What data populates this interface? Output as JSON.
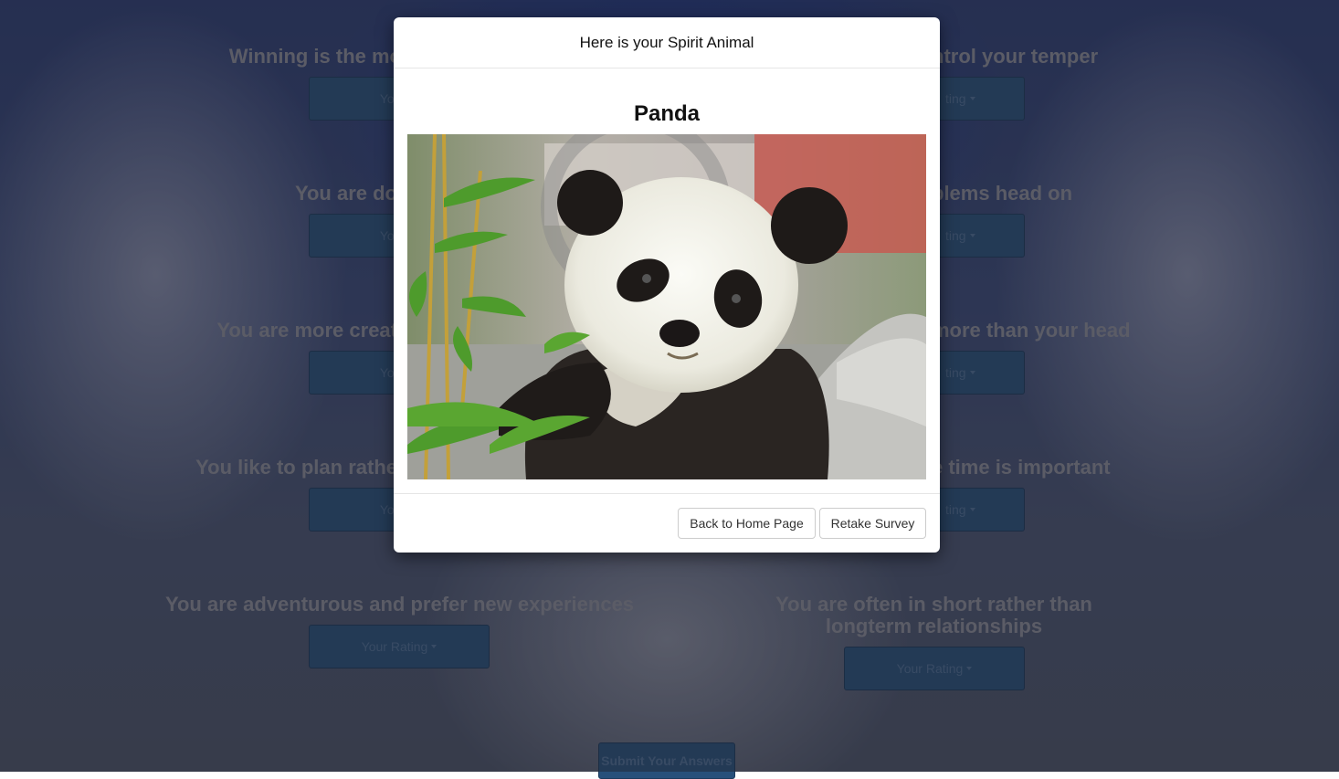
{
  "survey": {
    "questions": [
      {
        "text": "Winning is the mo",
        "rating_label": "Your R"
      },
      {
        "text": "ntrol your temper",
        "rating_label": "ting"
      },
      {
        "text": "You are do",
        "rating_label": "Your R"
      },
      {
        "text": "blems head on",
        "rating_label": "ting"
      },
      {
        "text": "You are more creat",
        "rating_label": "Your R"
      },
      {
        "text": "more than your head",
        "rating_label": "ting"
      },
      {
        "text": "You like to plan rathe",
        "rating_label": "Your R"
      },
      {
        "text": "e time is important",
        "rating_label": "ting"
      },
      {
        "text": "You are adventurous and prefer new experiences",
        "rating_label": "Your Rating"
      },
      {
        "text": "You are often in short rather than longterm relationships",
        "rating_label": "Your Rating"
      }
    ],
    "submit_label": "Submit Your Answers"
  },
  "modal": {
    "title": "Here is your Spirit Animal",
    "animal_name": "Panda",
    "photo_subject": "panda-eating-bamboo",
    "back_button": "Back to Home Page",
    "retake_button": "Retake Survey"
  },
  "colors": {
    "rating_button": "#27507a",
    "overlay": "#1e1e28",
    "modal_bg": "#ffffff"
  }
}
